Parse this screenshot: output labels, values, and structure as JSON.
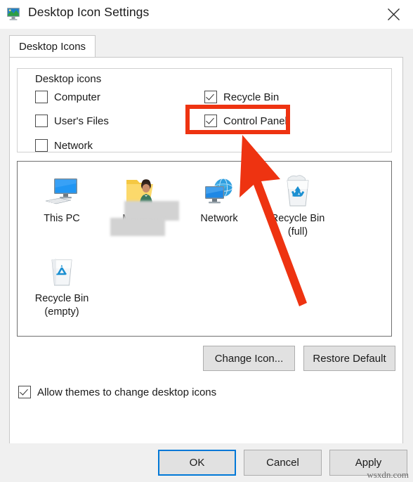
{
  "window": {
    "title": "Desktop Icon Settings",
    "title_icon": "monitor-desktop-icon",
    "close_icon": "close-icon"
  },
  "tabs": [
    {
      "label": "Desktop Icons",
      "active": true
    }
  ],
  "desktop_icons_group": {
    "legend": "Desktop icons",
    "left_column": [
      {
        "label": "Computer",
        "checked": false
      },
      {
        "label": "User's Files",
        "checked": false
      },
      {
        "label": "Network",
        "checked": false
      }
    ],
    "right_column": [
      {
        "label": "Recycle Bin",
        "checked": true
      },
      {
        "label": "Control Panel",
        "checked": true,
        "highlighted": true
      }
    ]
  },
  "preview": {
    "items": [
      {
        "caption": "This PC",
        "icon": "this-pc-icon",
        "redacted": false
      },
      {
        "caption": "Mahesh",
        "icon": "user-folder-icon",
        "redacted": true
      },
      {
        "caption": "Network",
        "icon": "network-icon",
        "redacted": false
      },
      {
        "caption": "Recycle Bin\n(full)",
        "icon": "recycle-bin-full-icon",
        "redacted": false
      },
      {
        "caption": "Recycle Bin\n(empty)",
        "icon": "recycle-bin-empty-icon",
        "redacted": false
      }
    ]
  },
  "icon_buttons": {
    "change_icon": "Change Icon...",
    "restore_default": "Restore Default"
  },
  "allow_themes": {
    "label": "Allow themes to change desktop icons",
    "checked": true
  },
  "footer": {
    "ok": "OK",
    "cancel": "Cancel",
    "apply": "Apply",
    "ok_focused": true
  },
  "watermark": "wsxdn.com",
  "annotation": {
    "color": "#ee3311",
    "highlight_target": "Control Panel",
    "arrow": "red-arrow-pointing-to-control-panel"
  }
}
